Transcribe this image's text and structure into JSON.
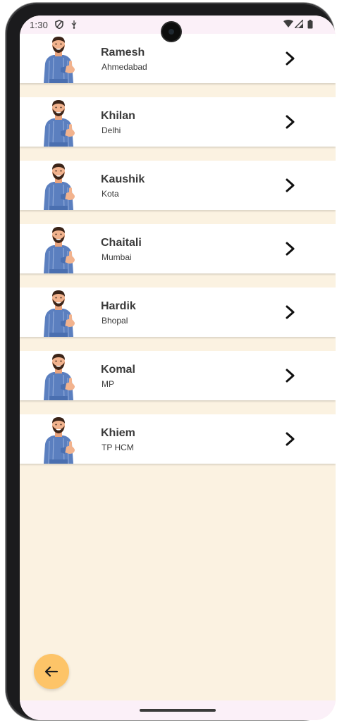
{
  "status_bar": {
    "time": "1:30",
    "icons": [
      "shield-icon",
      "usb-icon",
      "wifi-icon",
      "signal-icon",
      "battery-icon"
    ]
  },
  "people": [
    {
      "name": "Ramesh",
      "city": "Ahmedabad"
    },
    {
      "name": "Khilan",
      "city": "Delhi"
    },
    {
      "name": "Kaushik",
      "city": "Kota"
    },
    {
      "name": "Chaitali",
      "city": "Mumbai"
    },
    {
      "name": "Hardik",
      "city": "Bhopal"
    },
    {
      "name": "Komal",
      "city": "MP"
    },
    {
      "name": "Khiem",
      "city": "TP HCM"
    }
  ],
  "colors": {
    "background": "#fbf2e1",
    "card": "#ffffff",
    "fab": "#fdc468",
    "text": "#3a3a3a",
    "shirt": "#5b7fbf"
  },
  "back_button": {
    "icon": "arrow-left-icon"
  }
}
